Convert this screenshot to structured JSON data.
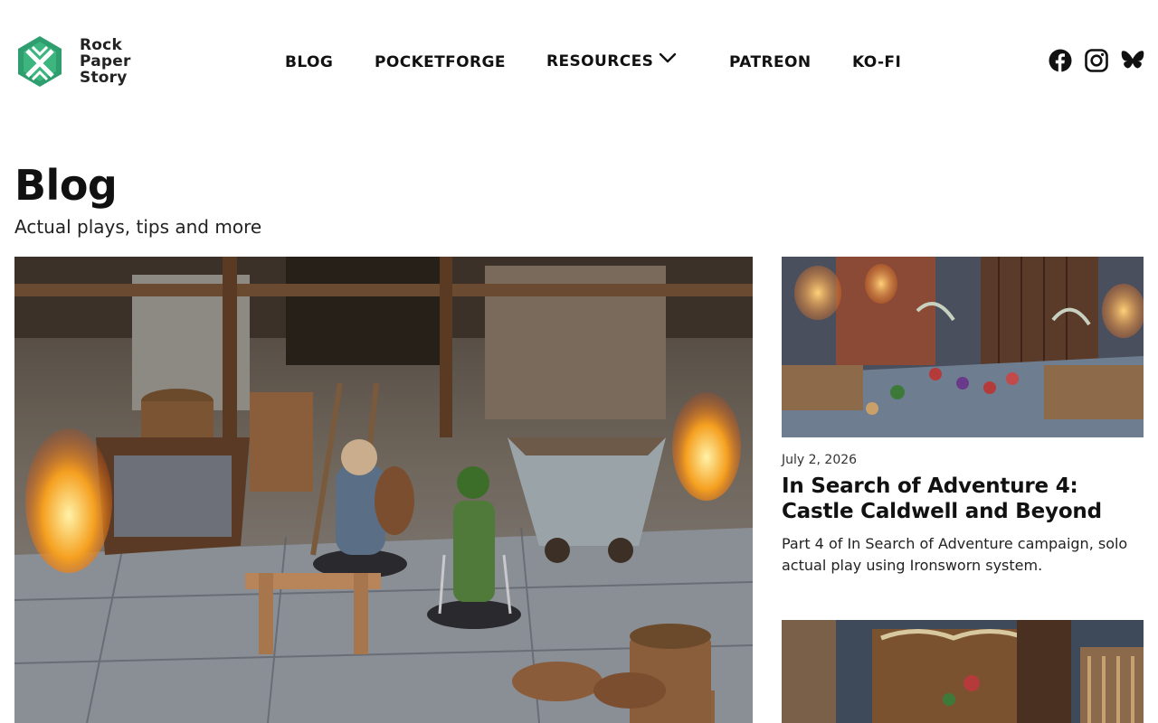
{
  "site": {
    "logo_lines": [
      "Rock",
      "Paper",
      "Story"
    ],
    "brand_color": "#2e9e6e"
  },
  "nav": {
    "items": [
      {
        "label": "BLOG"
      },
      {
        "label": "POCKETFORGE"
      },
      {
        "label": "RESOURCES",
        "has_dropdown": true
      },
      {
        "label": "PATREON"
      },
      {
        "label": "KO-FI"
      }
    ]
  },
  "social": {
    "icons": [
      "facebook-icon",
      "instagram-icon",
      "bluesky-icon"
    ]
  },
  "page": {
    "title": "Blog",
    "subtitle": "Actual plays, tips and more"
  },
  "featured_post": {
    "image_description": "miniature dwarf and ranger figures in a mine tunnel diorama"
  },
  "posts": [
    {
      "date": "July 2, 2026",
      "title": "In Search of Adventure 4: Castle Caldwell and Beyond",
      "excerpt": "Part 4 of In Search of Adventure campaign, solo actual play using Ironsworn system."
    }
  ]
}
